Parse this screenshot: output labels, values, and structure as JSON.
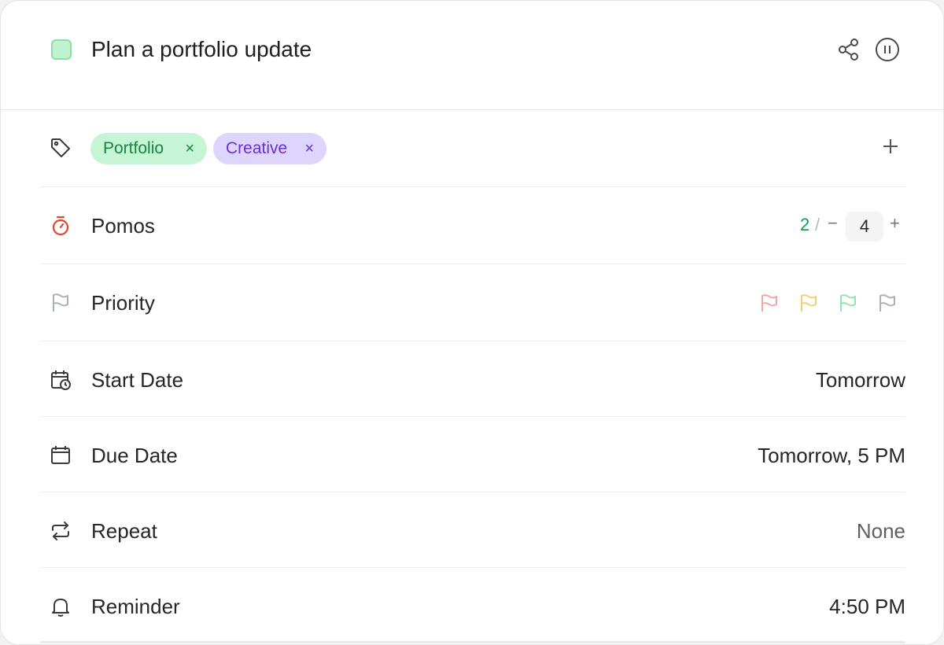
{
  "task": {
    "title": "Plan a portfolio update",
    "check_color": "#bff3d0"
  },
  "header": {
    "share_icon": "share-icon",
    "pause_icon": "pause-circle-icon"
  },
  "tags": {
    "icon": "tag-icon",
    "items": [
      {
        "label": "Portfolio",
        "remove": "×",
        "color": "#17843f",
        "bg": "#c5f5d5"
      },
      {
        "label": "Creative",
        "remove": "×",
        "color": "#6a2fd6",
        "bg": "#ddd5fb"
      }
    ],
    "add_icon": "plus-icon"
  },
  "pomos": {
    "label": "Pomos",
    "icon": "stopwatch-icon",
    "done": "2",
    "separator": "/",
    "minus": "−",
    "estimate": "4",
    "plus": "+"
  },
  "priority": {
    "label": "Priority",
    "icon": "flag-icon",
    "options": [
      {
        "level": "high",
        "color": "#f4a4a4"
      },
      {
        "level": "medium",
        "color": "#f3cf6e"
      },
      {
        "level": "low",
        "color": "#95e3b0"
      },
      {
        "level": "none",
        "color": "#a9b0bb"
      }
    ]
  },
  "start_date": {
    "label": "Start Date",
    "icon": "calendar-clock-icon",
    "value": "Tomorrow"
  },
  "due_date": {
    "label": "Due Date",
    "icon": "calendar-icon",
    "value": "Tomorrow, 5 PM"
  },
  "repeat": {
    "label": "Repeat",
    "icon": "repeat-icon",
    "value": "None"
  },
  "reminder": {
    "label": "Reminder",
    "icon": "bell-icon",
    "value": "4:50 PM"
  }
}
